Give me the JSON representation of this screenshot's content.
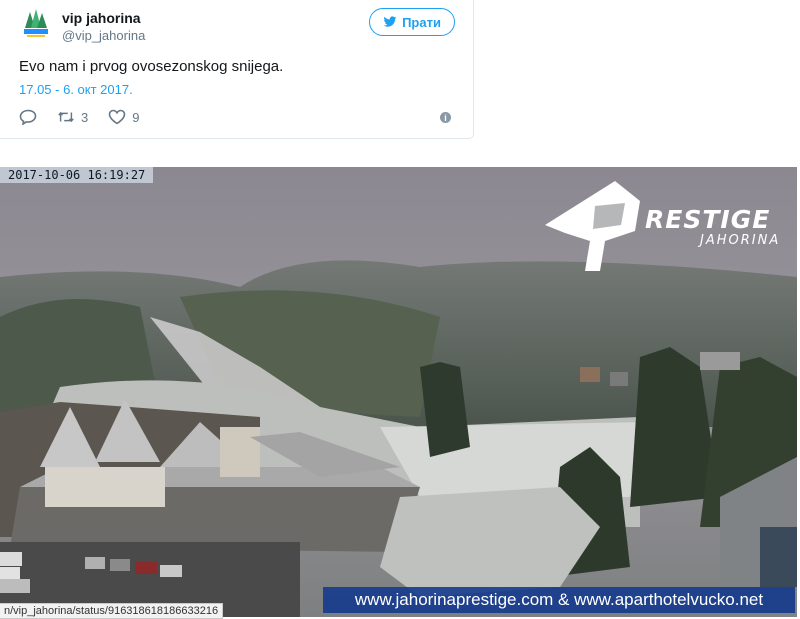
{
  "tweet": {
    "display_name": "vip jahorina",
    "handle": "@vip_jahorina",
    "follow_label": "Прати",
    "text": "Evo nam i prvog ovosezonskog snijega.",
    "date": "17.05 - 6. окт 2017.",
    "retweets": "3",
    "likes": "9"
  },
  "photo": {
    "timestamp": "2017-10-06  16:19:27",
    "logo_word": "RESTIGE",
    "logo_sub": "JAHORINA",
    "banner": "www.jahorinaprestige.com & www.aparthotelvucko.net"
  },
  "status_url": "n/vip_jahorina/status/916318618186633216",
  "colors": {
    "accent": "#1da1f2",
    "banner": "#12388c"
  }
}
